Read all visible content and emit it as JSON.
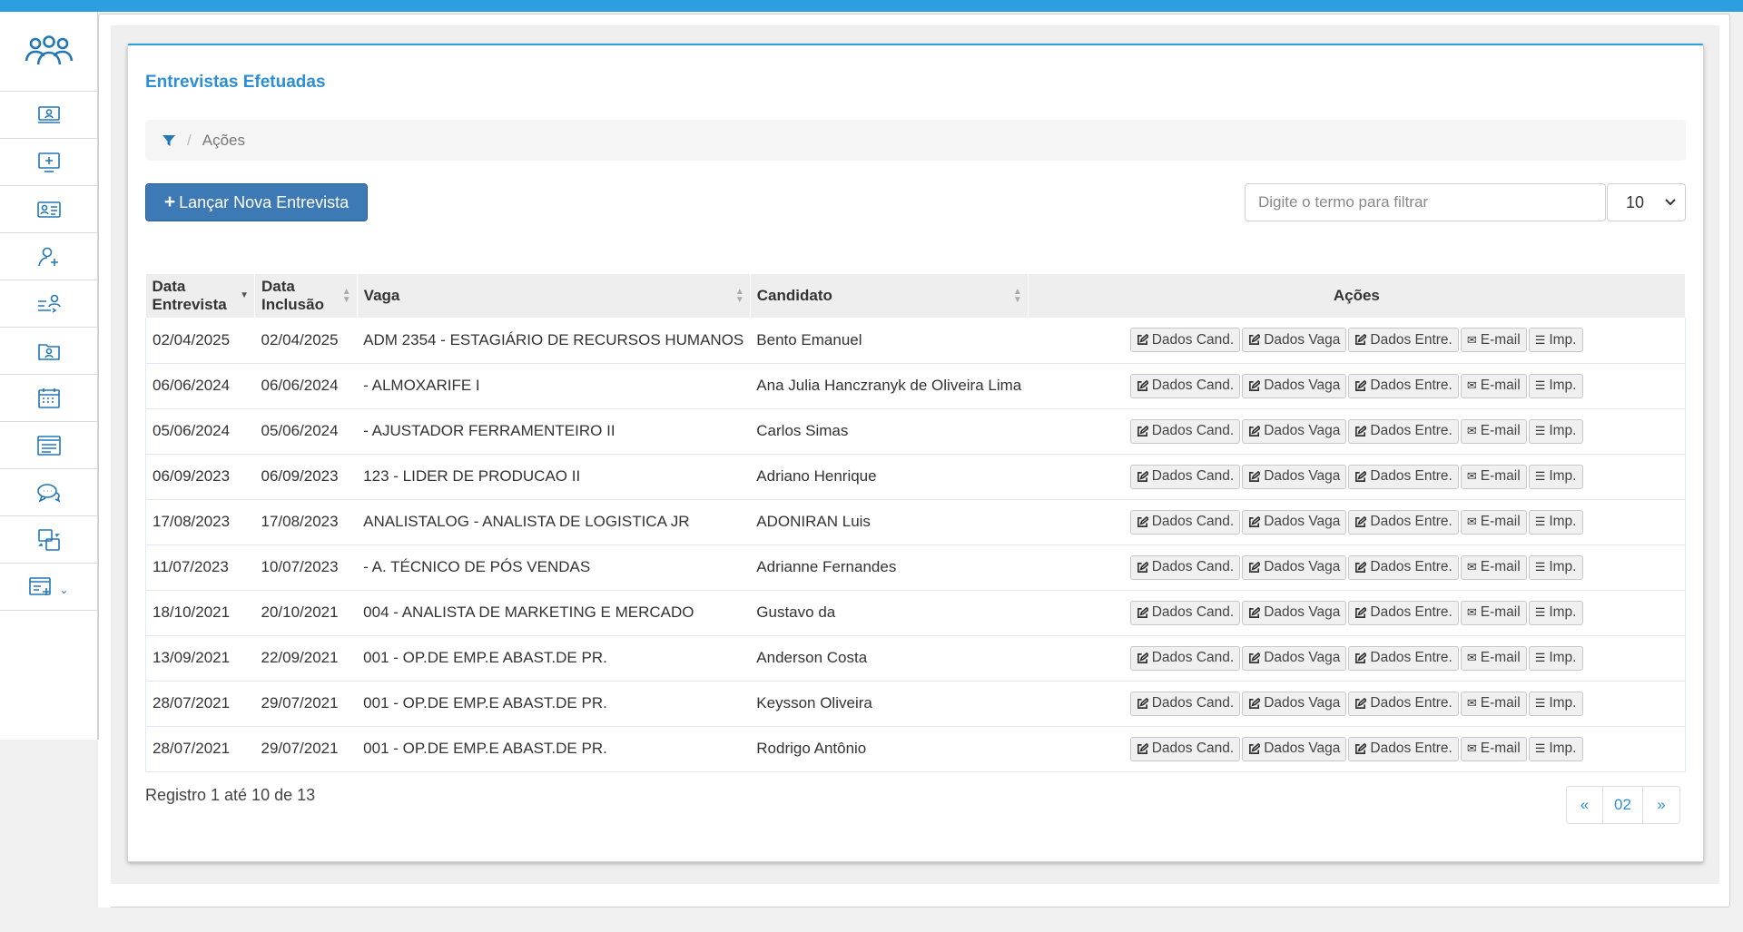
{
  "colors": {
    "accent": "#2b9fdf",
    "primary_button": "#3d7ab5",
    "title": "#2c8fd5"
  },
  "sidebar": {
    "logo_icon": "people-group-icon",
    "items": [
      {
        "icon": "monitor-user-icon"
      },
      {
        "icon": "monitor-add-icon"
      },
      {
        "icon": "id-card-icon"
      },
      {
        "icon": "user-add-icon"
      },
      {
        "icon": "user-flow-icon"
      },
      {
        "icon": "folder-user-icon"
      },
      {
        "icon": "calendar-icon"
      },
      {
        "icon": "list-window-icon"
      },
      {
        "icon": "chat-icon"
      },
      {
        "icon": "exchange-icon"
      },
      {
        "icon": "window-add-icon",
        "has_submenu": true
      }
    ]
  },
  "panel": {
    "title": "Entrevistas Efetuadas",
    "breadcrumb": {
      "icon": "filter-icon",
      "label": "Ações"
    },
    "new_button": "Lançar Nova Entrevista",
    "filter_placeholder": "Digite o termo para filtrar",
    "page_size": "10"
  },
  "table": {
    "headers": {
      "data_entrevista": "Data Entrevista",
      "data_inclusao": "Data Inclusão",
      "vaga": "Vaga",
      "candidato": "Candidato",
      "acoes": "Ações"
    },
    "sort_column": "Data Entrevista",
    "sort_direction": "desc",
    "action_labels": {
      "dados_cand": "Dados Cand.",
      "dados_vaga": "Dados Vaga",
      "dados_entre": "Dados Entre.",
      "email": "E-mail",
      "imp": "Imp."
    },
    "rows": [
      {
        "data_entrevista": "02/04/2025",
        "data_inclusao": "02/04/2025",
        "vaga": "ADM 2354 - ESTAGIÁRIO DE RECURSOS HUMANOS",
        "candidato": "Bento Emanuel"
      },
      {
        "data_entrevista": "06/06/2024",
        "data_inclusao": "06/06/2024",
        "vaga": "- ALMOXARIFE I",
        "candidato": "Ana Julia Hanczranyk de Oliveira Lima"
      },
      {
        "data_entrevista": "05/06/2024",
        "data_inclusao": "05/06/2024",
        "vaga": "- AJUSTADOR FERRAMENTEIRO II",
        "candidato": "Carlos Simas"
      },
      {
        "data_entrevista": "06/09/2023",
        "data_inclusao": "06/09/2023",
        "vaga": "123 - LIDER DE PRODUCAO II",
        "candidato": "Adriano Henrique"
      },
      {
        "data_entrevista": "17/08/2023",
        "data_inclusao": "17/08/2023",
        "vaga": "ANALISTALOG - ANALISTA DE LOGISTICA JR",
        "candidato": "ADONIRAN Luis"
      },
      {
        "data_entrevista": "11/07/2023",
        "data_inclusao": "10/07/2023",
        "vaga": "- A. TÉCNICO DE PÓS VENDAS",
        "candidato": "Adrianne Fernandes"
      },
      {
        "data_entrevista": "18/10/2021",
        "data_inclusao": "20/10/2021",
        "vaga": "004 - ANALISTA DE MARKETING E MERCADO",
        "candidato": "Gustavo da"
      },
      {
        "data_entrevista": "13/09/2021",
        "data_inclusao": "22/09/2021",
        "vaga": "001 - OP.DE EMP.E ABAST.DE PR.",
        "candidato": "Anderson Costa"
      },
      {
        "data_entrevista": "28/07/2021",
        "data_inclusao": "29/07/2021",
        "vaga": "001 - OP.DE EMP.E ABAST.DE PR.",
        "candidato": "Keysson Oliveira"
      },
      {
        "data_entrevista": "28/07/2021",
        "data_inclusao": "29/07/2021",
        "vaga": "001 - OP.DE EMP.E ABAST.DE PR.",
        "candidato": "Rodrigo Antônio"
      }
    ]
  },
  "footer": {
    "record_info": "Registro 1 até 10 de 13",
    "pager": {
      "prev": "«",
      "page": "02",
      "next": "»"
    }
  }
}
